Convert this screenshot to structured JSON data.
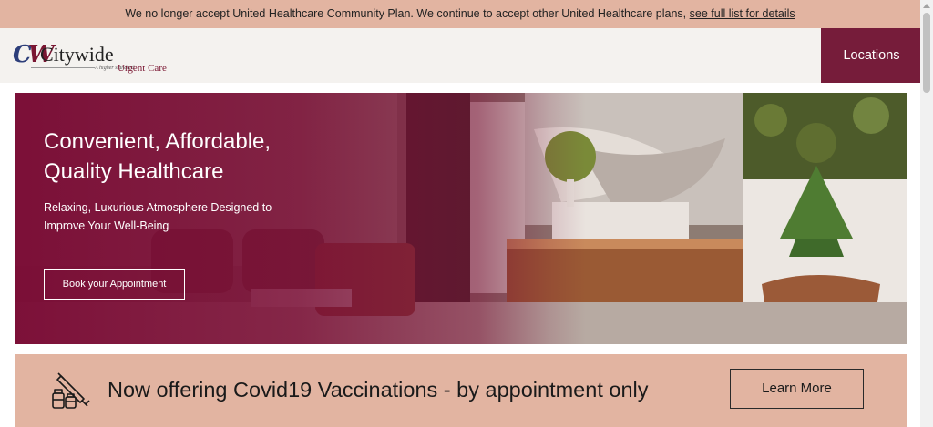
{
  "announcement": {
    "text": "We no longer accept United Healthcare Community Plan. We continue to accept other United Healthcare plans,",
    "link_label": "see full list for details"
  },
  "header": {
    "logo": {
      "name": "Citywide",
      "tagline": "A higher standard",
      "subtitle": "Urgent Care"
    },
    "nav": {
      "locations_label": "Locations"
    }
  },
  "hero": {
    "title_line1": "Convenient, Affordable,",
    "title_line2": "Quality Healthcare",
    "subtitle_line1": "Relaxing, Luxurious Atmosphere Designed to",
    "subtitle_line2": "Improve Your Well-Being",
    "cta_label": "Book your Appointment"
  },
  "covid_banner": {
    "icon": "vaccine-icon",
    "text": "Now offering Covid19 Vaccinations - by appointment only",
    "button_label": "Learn More"
  },
  "colors": {
    "brand": "#761c3a",
    "banner_bg": "#e2b4a1",
    "header_bg": "#f4f2ef"
  }
}
